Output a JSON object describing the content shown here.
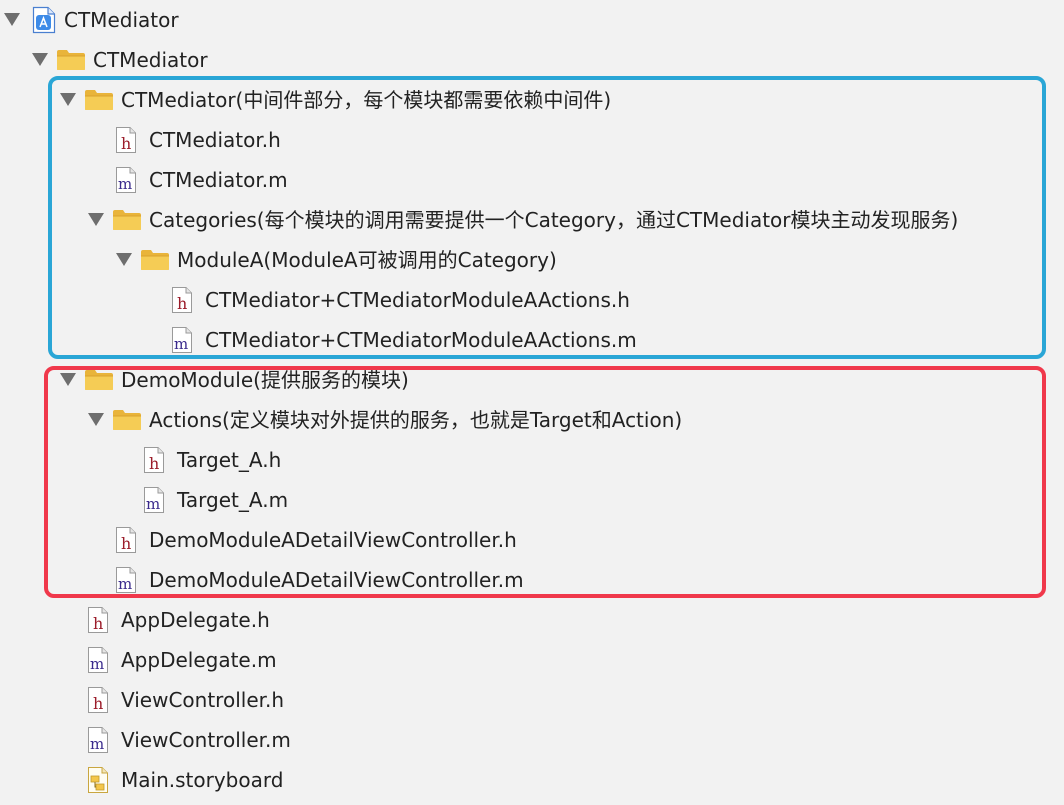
{
  "colors": {
    "background": "#f2f2f2",
    "blue_box": "#2aa6d6",
    "red_box": "#f0384b",
    "folder": "#f0c14b",
    "header_icon_letter": "#9b1c2a",
    "impl_icon_letter": "#3a2a8c"
  },
  "tree": {
    "project": {
      "label": "CTMediator",
      "icon": "xcode-project-icon"
    },
    "group_ctmediator": {
      "label": "CTMediator",
      "icon": "folder-icon"
    },
    "group_ctmediator_core": {
      "label": "CTMediator(中间件部分，每个模块都需要依赖中间件)",
      "icon": "folder-icon"
    },
    "file_ctmediator_h": {
      "label": "CTMediator.h",
      "icon": "header-file-icon"
    },
    "file_ctmediator_m": {
      "label": "CTMediator.m",
      "icon": "implementation-file-icon"
    },
    "group_categories": {
      "label": "Categories(每个模块的调用需要提供一个Category，通过CTMediator模块主动发现服务)",
      "icon": "folder-icon"
    },
    "group_modulea": {
      "label": "ModuleA(ModuleA可被调用的Category)",
      "icon": "folder-icon"
    },
    "file_modulea_actions_h": {
      "label": "CTMediator+CTMediatorModuleAActions.h",
      "icon": "header-file-icon"
    },
    "file_modulea_actions_m": {
      "label": "CTMediator+CTMediatorModuleAActions.m",
      "icon": "implementation-file-icon"
    },
    "group_demomodule": {
      "label": "DemoModule(提供服务的模块)",
      "icon": "folder-icon"
    },
    "group_actions": {
      "label": "Actions(定义模块对外提供的服务，也就是Target和Action)",
      "icon": "folder-icon"
    },
    "file_target_a_h": {
      "label": "Target_A.h",
      "icon": "header-file-icon"
    },
    "file_target_a_m": {
      "label": "Target_A.m",
      "icon": "implementation-file-icon"
    },
    "file_detail_vc_h": {
      "label": "DemoModuleADetailViewController.h",
      "icon": "header-file-icon"
    },
    "file_detail_vc_m": {
      "label": "DemoModuleADetailViewController.m",
      "icon": "implementation-file-icon"
    },
    "file_appdelegate_h": {
      "label": "AppDelegate.h",
      "icon": "header-file-icon"
    },
    "file_appdelegate_m": {
      "label": "AppDelegate.m",
      "icon": "implementation-file-icon"
    },
    "file_viewcontroller_h": {
      "label": "ViewController.h",
      "icon": "header-file-icon"
    },
    "file_viewcontroller_m": {
      "label": "ViewController.m",
      "icon": "implementation-file-icon"
    },
    "file_main_storyboard": {
      "label": "Main.storyboard",
      "icon": "storyboard-file-icon"
    }
  }
}
